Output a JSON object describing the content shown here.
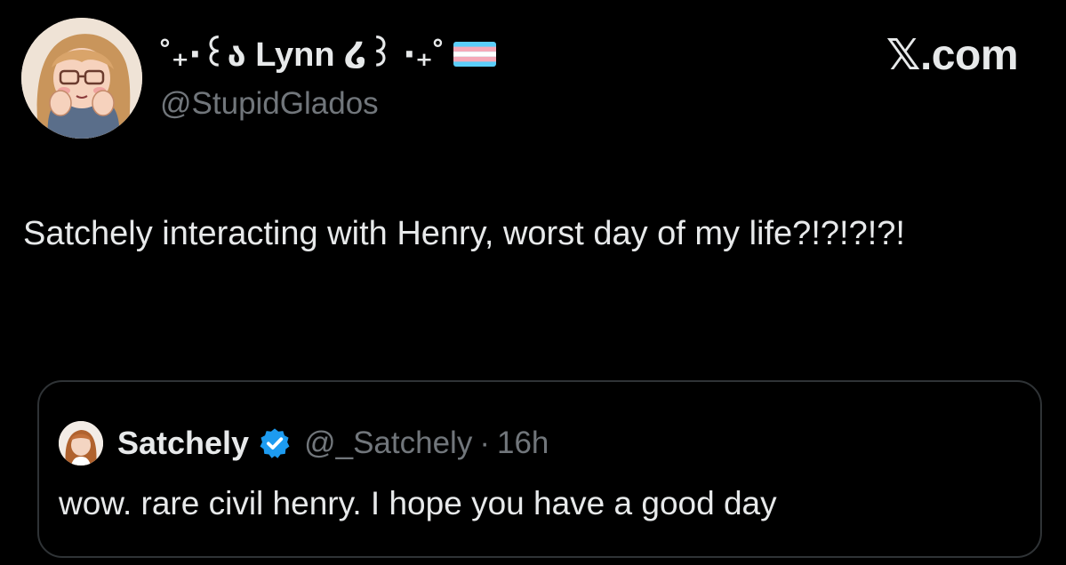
{
  "tweet": {
    "author": {
      "display_name": "˚₊‧꒰ა Lynn ໒꒱ ‧₊˚",
      "handle": "@StupidGlados",
      "flag_icon": "transgender-flag-icon"
    },
    "brand": "𝕏.com",
    "text": "Satchely interacting with Henry, worst day of my life?!?!?!?!"
  },
  "quote": {
    "author": {
      "display_name": "Satchely",
      "handle": "@_Satchely",
      "separator": "·",
      "timestamp": "16h",
      "verified_icon": "verified-badge-icon"
    },
    "text": "wow. rare civil henry. I hope you have a good day"
  },
  "colors": {
    "background": "#000000",
    "primary_text": "#e7e9ea",
    "secondary_text": "#71767b",
    "border": "#2f3336",
    "verified": "#1d9bf0",
    "flag_blue": "#5bcefa",
    "flag_pink": "#f5a9b8",
    "flag_white": "#ffffff"
  }
}
